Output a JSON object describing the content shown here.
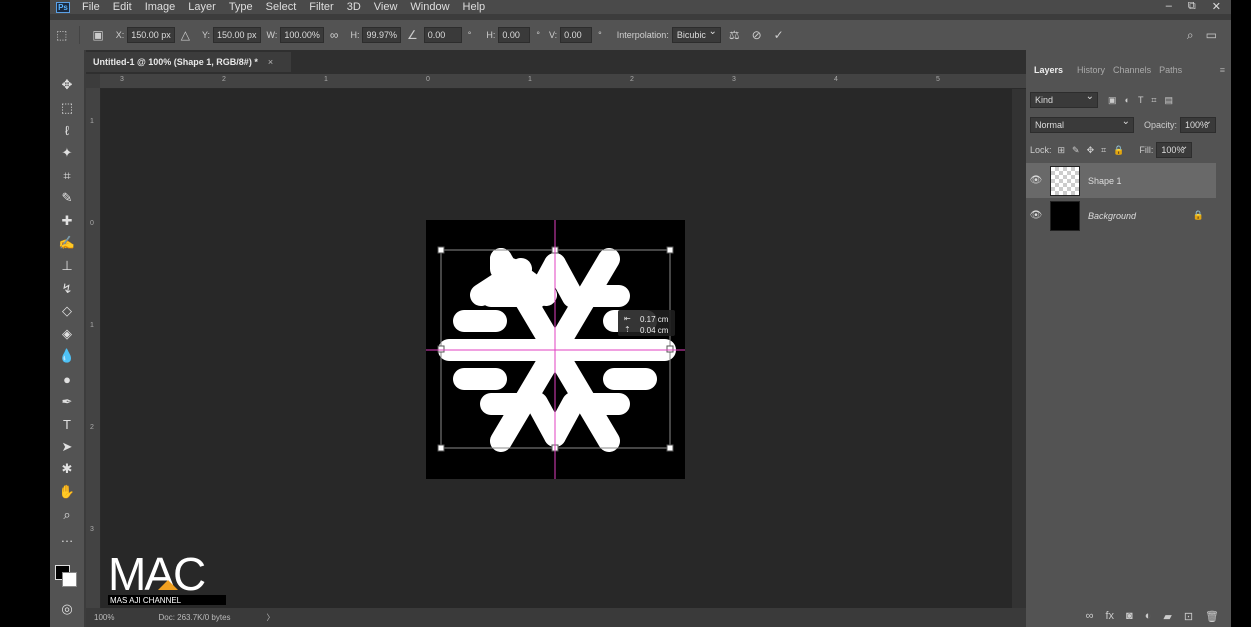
{
  "app": {
    "logo": "Ps"
  },
  "menu": [
    "File",
    "Edit",
    "Image",
    "Layer",
    "Type",
    "Select",
    "Filter",
    "3D",
    "View",
    "Window",
    "Help"
  ],
  "window_controls": {
    "minimize": "–",
    "restore": "⧉",
    "close": "✕"
  },
  "options": {
    "x_label": "X:",
    "x_value": "150.00 px",
    "y_label": "Y:",
    "y_value": "150.00 px",
    "w_label": "W:",
    "w_value": "100.00%",
    "h_label": "H:",
    "h_value": "99.97%",
    "angle_value": "0.00",
    "hskew_label": "H:",
    "hskew_value": "0.00",
    "vskew_label": "V:",
    "vskew_value": "0.00",
    "degree": "°",
    "interp_label": "Interpolation:",
    "interp_value": "Bicubic"
  },
  "document": {
    "tab_title": "Untitled-1 @ 100% (Shape 1, RGB/8#) *",
    "close": "×",
    "ruler_top": [
      "3",
      "2",
      "1",
      "0",
      "1",
      "2",
      "3",
      "4",
      "5"
    ],
    "ruler_left": [
      "1",
      "0",
      "1",
      "2",
      "3"
    ],
    "readout_x": "0.17 cm",
    "readout_y": "0.04 cm"
  },
  "status": {
    "zoom": "100%",
    "doc": "Doc: 263.7K/0 bytes",
    "arrow": "〉"
  },
  "panels": {
    "tabs": [
      "Layers",
      "History",
      "Channels",
      "Paths"
    ],
    "kind": "Kind",
    "blend": "Normal",
    "opacity_label": "Opacity:",
    "opacity_value": "100%",
    "lock_label": "Lock:",
    "fill_label": "Fill:",
    "fill_value": "100%",
    "layers": [
      {
        "name": "Shape 1"
      },
      {
        "name": "Background"
      }
    ]
  },
  "watermark": {
    "logo": "MAC",
    "sub": "MAS AJI CHANNEL"
  }
}
